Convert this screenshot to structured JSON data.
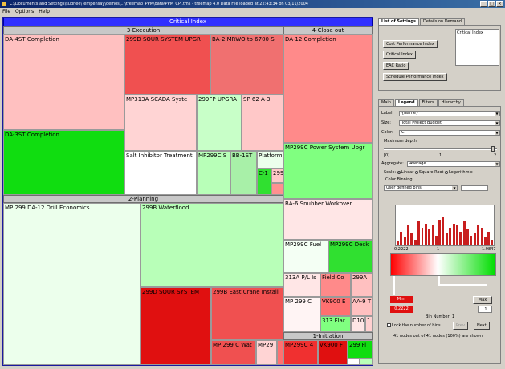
{
  "window": {
    "title": "C:\\Documents and Settings\\sudhee\\Tempensay\\demos\\...\\treemap_PPM\\data\\PPM_CPI.tms - treemap 4.0        Data File loaded at 22:43:34 on 03/11/2004",
    "buttons": [
      "_",
      "□",
      "×"
    ]
  },
  "menu": [
    "File",
    "Options",
    "Help"
  ],
  "treemap": {
    "root": "Critical Index",
    "groups": {
      "execution": "3-Execution",
      "closeout": "4-Close out",
      "planning": "2-Planning",
      "initiation": "1-Initiation"
    },
    "cells": {
      "da4st": "DA-4ST Completion",
      "da3st": "DA-3ST Completion",
      "d299_sour_upgr": "299D SOUR SYSTEM UPGR",
      "ba2": "BA-2 MRWO to 6700 S",
      "mp313a": "MP313A SCADA Syste",
      "p299fp": "299FP UPGRA",
      "sp62": "SP 62 A-3",
      "salt": "Salt Inhibitor Treatment",
      "mp299c_s": "MP299C S",
      "bb1st": "BB-1ST",
      "platform": "Platform",
      "c1": "C-1",
      "c299": "299",
      "da12": "DA-12 Completion",
      "mp299c_power": "MP299C Power System Upgr",
      "ba6": "BA-6 Snubber Workover",
      "mp299c_fuel": "MP299C Fuel",
      "mp299c_deck": "MP299C Deck",
      "p313a": "313A P/L Is",
      "field_co": "Field Co",
      "a299a": "299A",
      "mp299c": "MP 299 C",
      "vk900e": "VK900 E",
      "aa9t": "AA-9 T",
      "f313": "313 Flar",
      "d10": "D10",
      "one": "1",
      "mp299_drill": "MP 299 DA-12 Drill Economics",
      "b299_waterflood": "299B Waterflood",
      "d299_sour_sys": "299D SOUR SYSTEM",
      "b299_crane": "299B East Crane Install",
      "mp299c_wat": "MP 299 C Wat",
      "mp29": "MP29",
      "i_mp299c4": "MP299C 4",
      "i_vk900f": "VK900 F",
      "i_299fi": "299 Fi"
    }
  },
  "settings": {
    "tabs": [
      "List of Settings",
      "Details on Demand"
    ],
    "buttons": [
      "Cost Performance Index",
      "Critical Index",
      "EAC Ratio",
      "Schedule Performance Index"
    ],
    "list_selected": "Critical Index"
  },
  "legend": {
    "tabs": [
      "Main",
      "Legend",
      "Filters",
      "Hierarchy"
    ],
    "label": {
      "caption": "Label:",
      "value": "{Name}"
    },
    "size": {
      "caption": "Size:",
      "value": "Total Project Budget"
    },
    "color": {
      "caption": "Color:",
      "value": "CI"
    },
    "max_depth": {
      "caption": "Maximum depth",
      "min": "[0]",
      "mid": "1",
      "max": "2"
    },
    "aggregate": {
      "caption": "Aggregate:",
      "value": "Average"
    },
    "scale": {
      "caption": "Scale:",
      "options": [
        "Linear",
        "Square Root",
        "Logarithmic"
      ],
      "selected": "Linear"
    },
    "color_binning": "Color Binning",
    "binning_mode": "User defined bins",
    "hist_min": "0.2222",
    "hist_mid": "1",
    "hist_max": "1.9847",
    "histogram_levels": [
      0.1,
      0.35,
      0.2,
      0.5,
      0.3,
      0.15,
      0.6,
      0.45,
      0.55,
      0.4,
      0.5,
      0.25,
      0.65,
      0.7,
      0.3,
      0.45,
      0.55,
      0.5,
      0.35,
      0.6,
      0.4,
      0.25,
      0.3,
      0.5,
      0.45,
      0.2,
      0.35,
      0.15
    ],
    "min_field": "Min:",
    "min_value": "0.2222",
    "max_label": "Max",
    "max_value": "1",
    "bin_number": "Bin Number: 1",
    "lock_bins": "Lock the number of bins",
    "prev": "Prev",
    "next": "Next",
    "status": "41 nodes out of 41 nodes (100%) are shown"
  },
  "colors": {
    "light_pink": "#ffc0c0",
    "pink": "#ff8a8a",
    "red": "#f03030",
    "deep_red": "#e01010",
    "pale_pink": "#ffe6e6",
    "white": "#ffffff",
    "pale_green": "#ecffec",
    "light_green": "#b8ffb8",
    "green": "#30e030",
    "bright_green": "#10dd10"
  }
}
